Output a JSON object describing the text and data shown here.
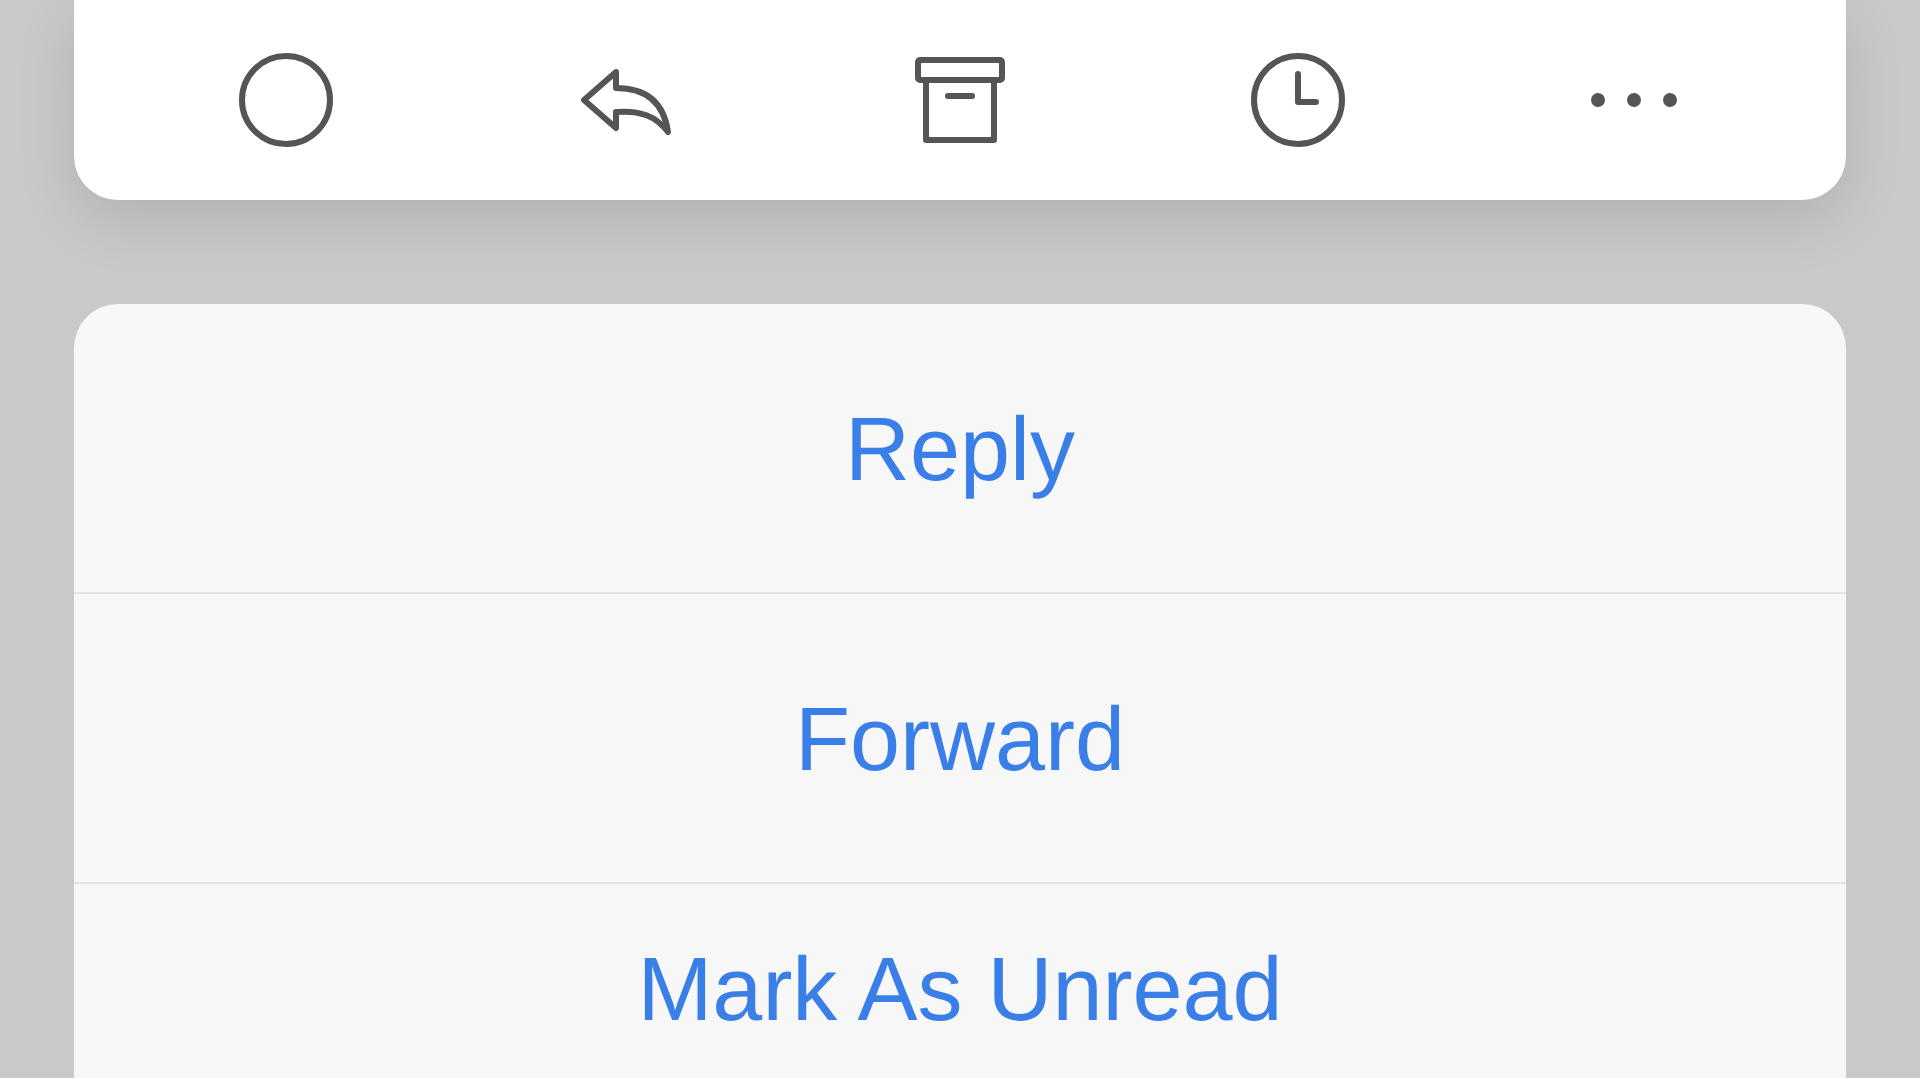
{
  "toolbar": [
    {
      "kind": "circle"
    },
    {
      "kind": "reply"
    },
    {
      "kind": "archive"
    },
    {
      "kind": "clock"
    },
    {
      "kind": "more"
    }
  ],
  "action_sheet": {
    "items": [
      "Reply",
      "Forward",
      "Mark As Unread"
    ]
  }
}
